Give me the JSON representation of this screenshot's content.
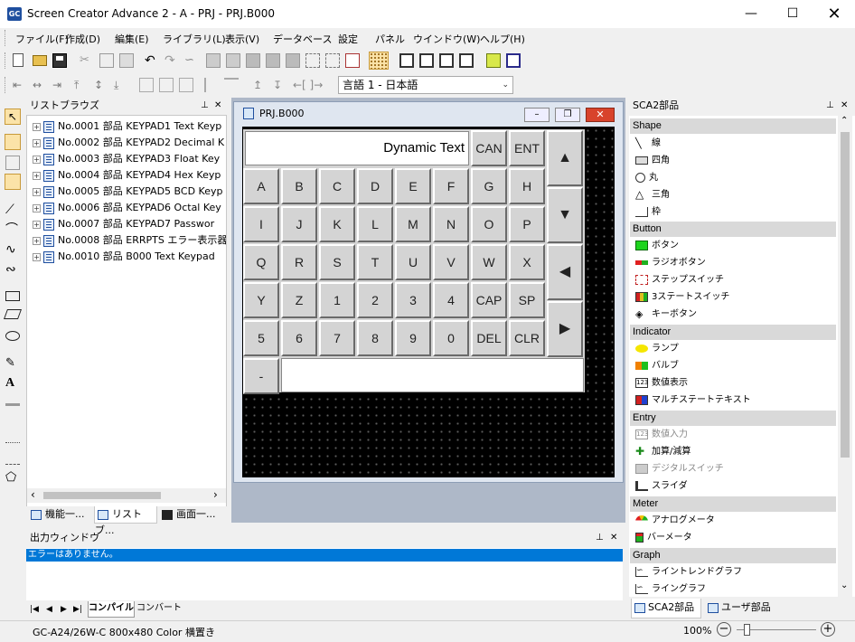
{
  "window": {
    "title": "Screen Creator Advance 2 - A - PRJ - PRJ.B000",
    "logo": "GC"
  },
  "menu": [
    "ファイル(F)",
    "作成(D)",
    "編集(E)",
    "ライブラリ(L)",
    "表示(V)",
    "データベース",
    "設定",
    "パネル",
    "ウインドウ(W)",
    "ヘルプ(H)"
  ],
  "language_select": "言語 1 - 日本語",
  "library": {
    "title": "リストブラウズ",
    "items": [
      "No.0001 部品 KEYPAD1  Text Keyp",
      "No.0002 部品 KEYPAD2  Decimal K",
      "No.0003 部品 KEYPAD3  Float Key",
      "No.0004 部品 KEYPAD4  Hex Keyp",
      "No.0005 部品 KEYPAD5  BCD Keyp",
      "No.0006 部品 KEYPAD6  Octal Key",
      "No.0007 部品 KEYPAD7  Passwor",
      "No.0008 部品 ERRPTS  エラー表示器",
      "No.0010 部品 B000       Text Keypad"
    ],
    "tabs": [
      "機能一...",
      "リストブ...",
      "画面一..."
    ]
  },
  "doc_window": {
    "title": "PRJ.B000"
  },
  "keypad": {
    "display_text": "Dynamic Text",
    "top_keys": [
      "CAN",
      "ENT"
    ],
    "rows": [
      [
        "A",
        "B",
        "C",
        "D",
        "E",
        "F",
        "G",
        "H"
      ],
      [
        "I",
        "J",
        "K",
        "L",
        "M",
        "N",
        "O",
        "P"
      ],
      [
        "Q",
        "R",
        "S",
        "T",
        "U",
        "V",
        "W",
        "X"
      ],
      [
        "Y",
        "Z",
        "1",
        "2",
        "3",
        "4",
        "CAP",
        "SP"
      ],
      [
        "5",
        "6",
        "7",
        "8",
        "9",
        "0",
        "DEL",
        "CLR"
      ]
    ],
    "minus_key": "-",
    "arrows": [
      "▲",
      "▼",
      "◀",
      "▶"
    ]
  },
  "parts": {
    "title": "SCA2部品",
    "categories": [
      {
        "name": "Shape",
        "items": [
          "線",
          "四角",
          "丸",
          "三角",
          "枠"
        ]
      },
      {
        "name": "Button",
        "items": [
          "ボタン",
          "ラジオボタン",
          "ステップスイッチ",
          "3ステートスイッチ",
          "キーボタン"
        ]
      },
      {
        "name": "Indicator",
        "items": [
          "ランプ",
          "バルブ",
          "数値表示",
          "マルチステートテキスト"
        ]
      },
      {
        "name": "Entry",
        "items": [
          "数値入力",
          "加算/減算",
          "デジタルスイッチ",
          "スライダ"
        ]
      },
      {
        "name": "Meter",
        "items": [
          "アナログメータ",
          "バーメータ"
        ]
      },
      {
        "name": "Graph",
        "items": [
          "ライントレンドグラフ",
          "ライングラフ"
        ]
      }
    ],
    "tabs": [
      "SCA2部品",
      "ユーザ部品"
    ]
  },
  "output": {
    "title": "出力ウィンドウ",
    "message": "エラーはありません。",
    "tabs": [
      "コンパイル",
      "コンバート"
    ]
  },
  "status": {
    "device": "GC-A24/26W-C 800x480 Color 横置き",
    "zoom": "100%"
  },
  "colors": {
    "selection": "#0078d7",
    "canvas": "#000000"
  }
}
